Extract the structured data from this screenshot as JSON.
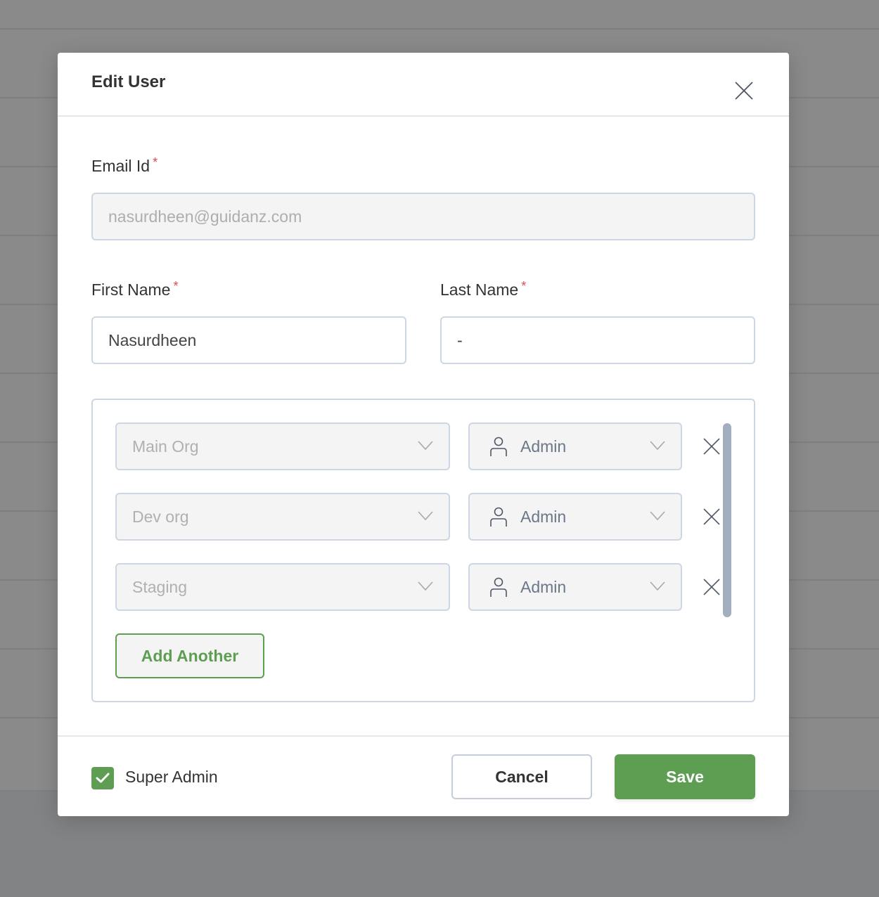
{
  "modal": {
    "title": "Edit User",
    "close_icon": "close-icon"
  },
  "form": {
    "email": {
      "label": "Email Id",
      "required_mark": "*",
      "value": "nasurdheen@guidanz.com",
      "disabled": true
    },
    "first_name": {
      "label": "First Name",
      "required_mark": "*",
      "value": "Nasurdheen"
    },
    "last_name": {
      "label": "Last Name",
      "required_mark": "*",
      "value": "-"
    }
  },
  "org_roles": [
    {
      "org": "Main Org",
      "role": "Admin",
      "role_icon": "user-icon",
      "remove_icon": "close-icon"
    },
    {
      "org": "Dev org",
      "role": "Admin",
      "role_icon": "user-icon",
      "remove_icon": "close-icon"
    },
    {
      "org": "Staging",
      "role": "Admin",
      "role_icon": "user-icon",
      "remove_icon": "close-icon"
    }
  ],
  "add_another_label": "Add Another",
  "footer": {
    "super_admin_label": "Super Admin",
    "super_admin_checked": true,
    "cancel_label": "Cancel",
    "save_label": "Save"
  },
  "colors": {
    "primary_green": "#5e9e52",
    "required_red": "#e14b4b",
    "border": "#cdd6e4",
    "scrollbar": "#a3aebf"
  }
}
